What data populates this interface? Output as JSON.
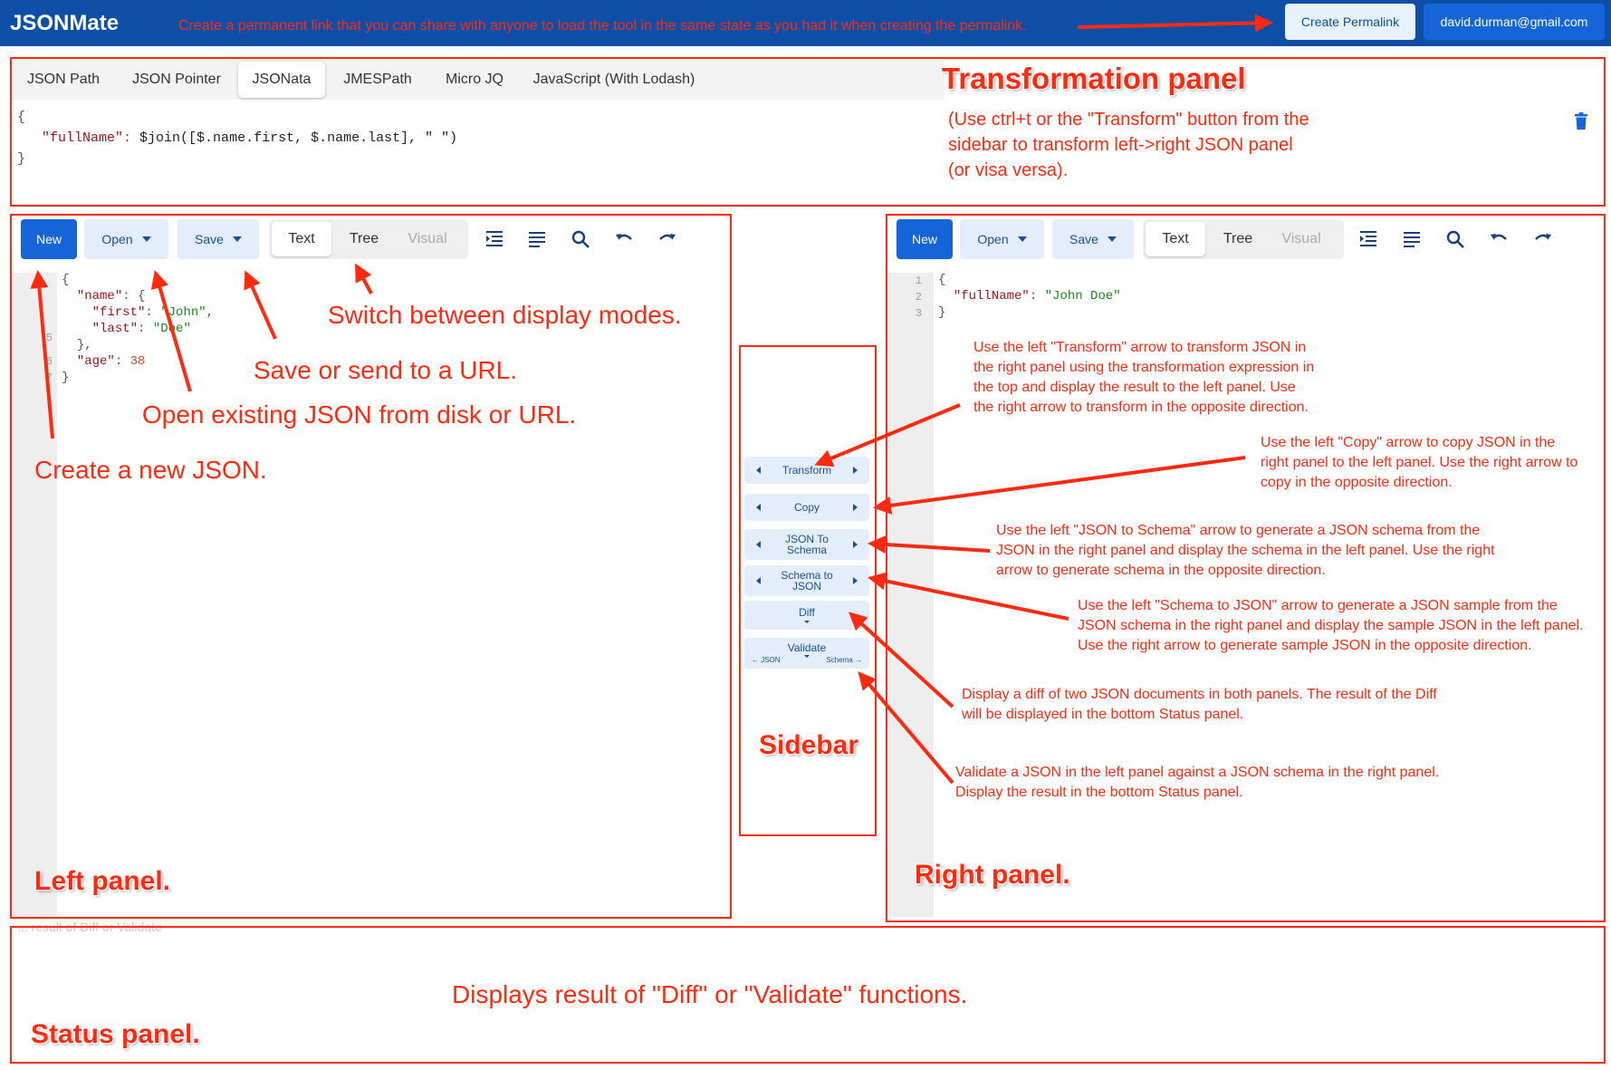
{
  "header": {
    "app_title": "JSONMate",
    "note": "Create a permanent link that you can share with anyone to load the tool in the same state as you had it when creating the permalink.",
    "permalink_label": "Create Permalink",
    "user_email": "david.durman@gmail.com"
  },
  "transformation": {
    "tabs": [
      {
        "label": "JSON Path",
        "active": false
      },
      {
        "label": "JSON Pointer",
        "active": false
      },
      {
        "label": "JSONata",
        "active": true
      },
      {
        "label": "JMESPath",
        "active": false
      },
      {
        "label": "Micro JQ",
        "active": false
      },
      {
        "label": "JavaScript (With Lodash)",
        "active": false
      }
    ],
    "expression_line1": "{",
    "expression_key": "\"fullName\"",
    "expression_value": "$join([$.name.first, $.name.last], \" \")",
    "expression_line3": "}",
    "panel_title": "Transformation panel",
    "note": "(Use ctrl+t or the \"Transform\" button from the sidebar to transform left->right JSON panel (or visa versa)."
  },
  "editor_toolbar": {
    "new_label": "New",
    "open_label": "Open",
    "save_label": "Save",
    "modes": [
      "Text",
      "Tree",
      "Visual"
    ]
  },
  "left_editor": {
    "line_numbers": [
      "1",
      "2",
      "3",
      "4",
      "5",
      "6",
      "7"
    ],
    "key_name": "\"name\"",
    "key_first": "\"first\"",
    "val_first": "\"John\"",
    "key_last": "\"last\"",
    "val_last": "\"Doe\"",
    "key_age": "\"age\"",
    "val_age": "38",
    "panel_label": "Left panel."
  },
  "right_editor": {
    "line_numbers": [
      "1",
      "2",
      "3"
    ],
    "key_fullname": "\"fullName\"",
    "val_fullname": "\"John Doe\"",
    "panel_label": "Right panel."
  },
  "sidebar": {
    "transform": "Transform",
    "copy": "Copy",
    "json_to_schema": "JSON To Schema",
    "schema_to_json": "Schema to JSON",
    "diff": "Diff",
    "validate": "Validate",
    "validate_left_hint": "← JSON",
    "validate_right_hint": "Schema →",
    "label": "Sidebar"
  },
  "annotations": {
    "switch_modes": "Switch between display modes.",
    "save": "Save or send to a URL.",
    "open": "Open existing JSON from disk or URL.",
    "create": "Create a new JSON.",
    "transform": "Use the left \"Transform\" arrow to transform JSON in the right panel using the transformation expression in the top and display the result to the left panel. Use the right arrow to transform in the opposite direction.",
    "copy": "Use the left \"Copy\" arrow to copy JSON in the right panel to the left panel. Use the right arrow to copy in the opposite direction.",
    "json_to_schema": "Use the left \"JSON to Schema\" arrow to generate a JSON schema from the JSON in the right panel and display the schema in the left panel. Use the right arrow to generate schema in the opposite direction.",
    "schema_to_json": "Use the left \"Schema to JSON\" arrow to generate a JSON sample from the JSON schema in the right panel and display the sample JSON in the left panel. Use the right arrow to generate sample JSON in the opposite direction.",
    "diff": "Display a diff of two JSON documents in both panels. The result of the Diff will be displayed in the bottom Status panel.",
    "validate": "Validate a JSON in the left panel against a JSON schema in the right panel. Display the result in the bottom Status panel."
  },
  "status": {
    "placeholder": "... result of Diff or Validate",
    "description": "Displays result of \"Diff\" or \"Validate\" functions.",
    "label": "Status panel."
  },
  "colors": {
    "header_bg": "#0d4ea6",
    "annotation_red": "#ff2a10",
    "primary_button": "#1565d8",
    "light_button": "#e4eefb"
  }
}
